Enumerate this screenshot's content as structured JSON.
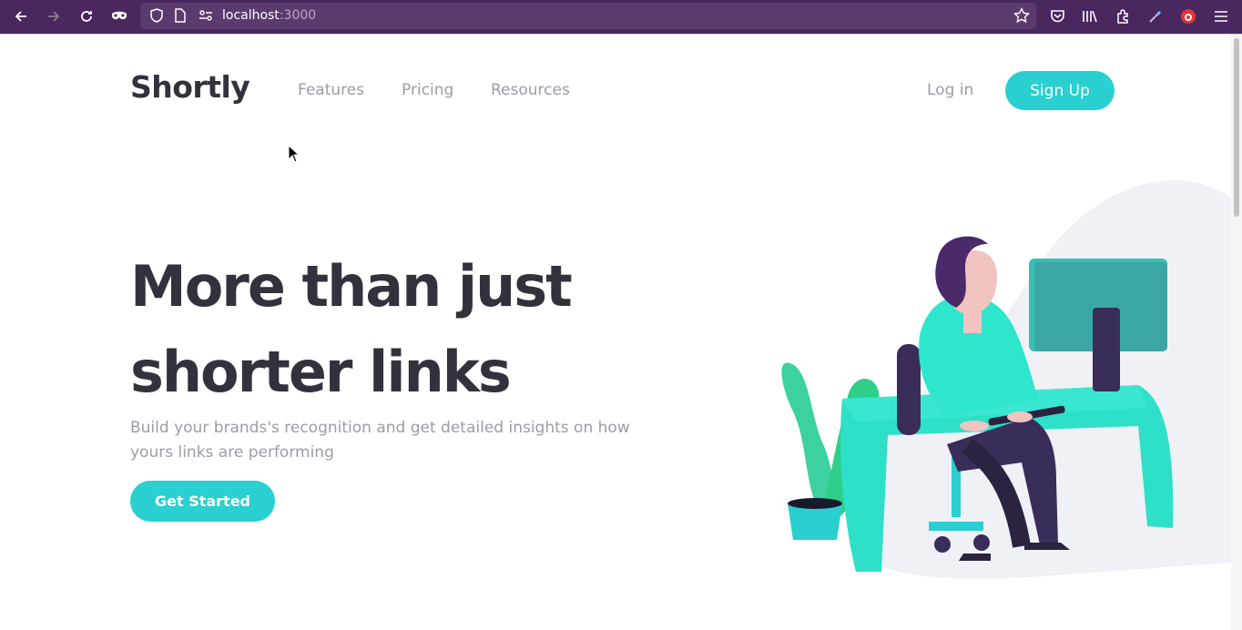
{
  "browser": {
    "url_host": "localhost",
    "url_port": ":3000",
    "icons": [
      "back-icon",
      "forward-icon",
      "reload-icon",
      "private-browsing-icon",
      "shield-icon",
      "page-icon",
      "permissions-icon",
      "bookmark-star-icon",
      "pocket-icon",
      "library-icon",
      "extensions-icon",
      "eyedropper-icon",
      "addon-icon",
      "menu-icon"
    ]
  },
  "header": {
    "logo": "Shortly",
    "nav": [
      "Features",
      "Pricing",
      "Resources"
    ],
    "login": "Log in",
    "signup": "Sign Up"
  },
  "hero": {
    "title_line1": "More than just",
    "title_line2": "shorter links",
    "subtitle": "Build your brands's recognition and get detailed insights on how yours links are performing",
    "cta": "Get Started"
  },
  "colors": {
    "accent": "#2acfcf",
    "dark": "#34313d",
    "muted": "#9e9aa7",
    "browser_bg": "#4a275e"
  }
}
